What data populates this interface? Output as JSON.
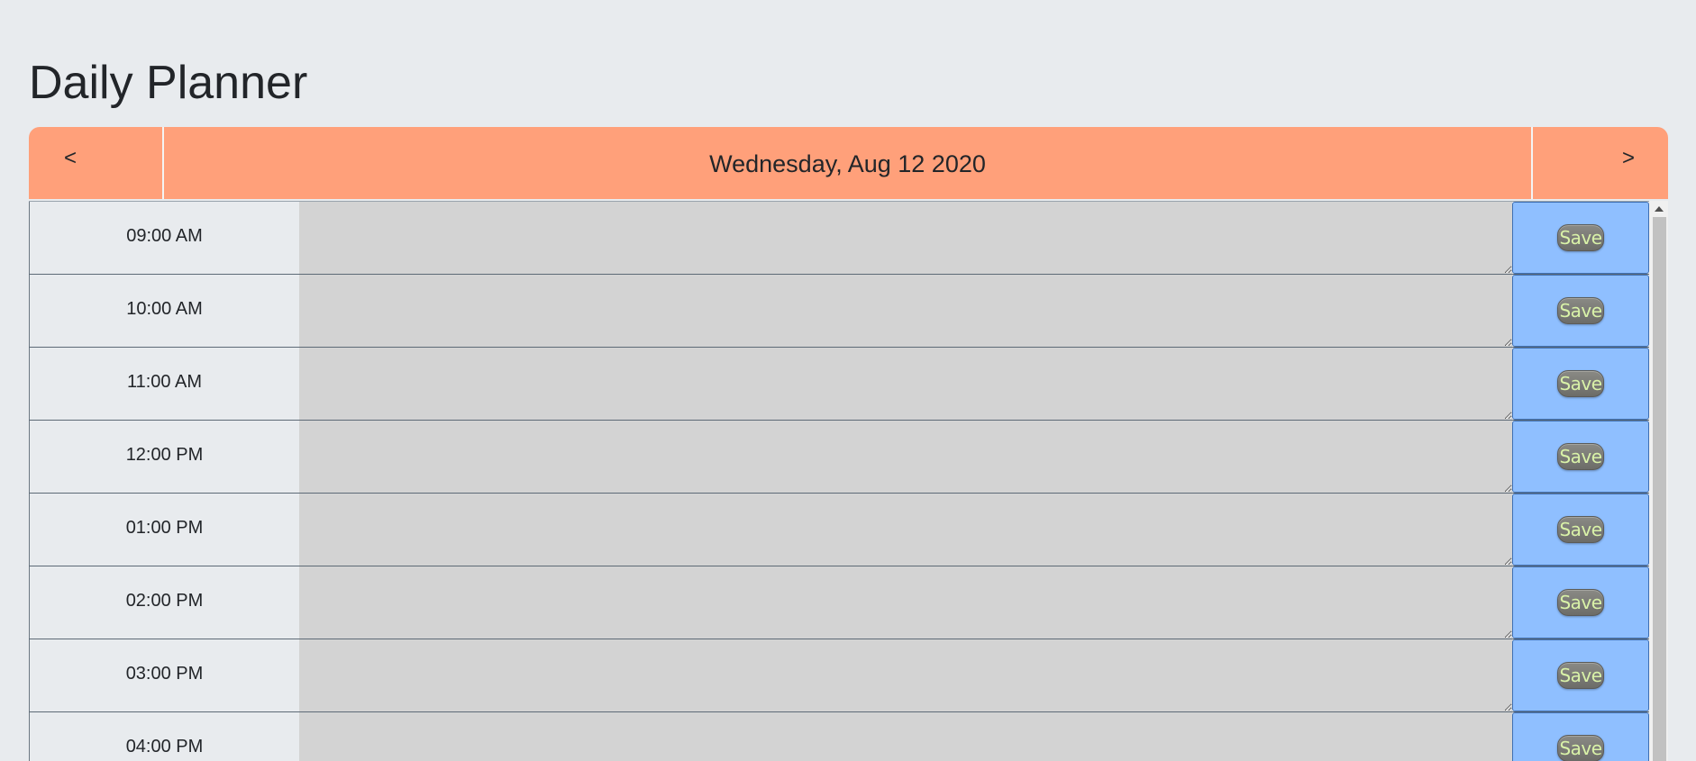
{
  "page": {
    "title": "Daily Planner"
  },
  "header": {
    "prev_label": "<",
    "next_label": ">",
    "date": "Wednesday, Aug 12 2020"
  },
  "hours": [
    {
      "label": "09:00 AM",
      "text": ""
    },
    {
      "label": "10:00 AM",
      "text": ""
    },
    {
      "label": "11:00 AM",
      "text": ""
    },
    {
      "label": "12:00 PM",
      "text": ""
    },
    {
      "label": "01:00 PM",
      "text": ""
    },
    {
      "label": "02:00 PM",
      "text": ""
    },
    {
      "label": "03:00 PM",
      "text": ""
    },
    {
      "label": "04:00 PM",
      "text": ""
    }
  ],
  "save_label": "Save",
  "colors": {
    "header": "#ffa07a",
    "background": "#e8ebee",
    "textarea": "#d3d3d3",
    "save_cell": "#8fbfff"
  }
}
